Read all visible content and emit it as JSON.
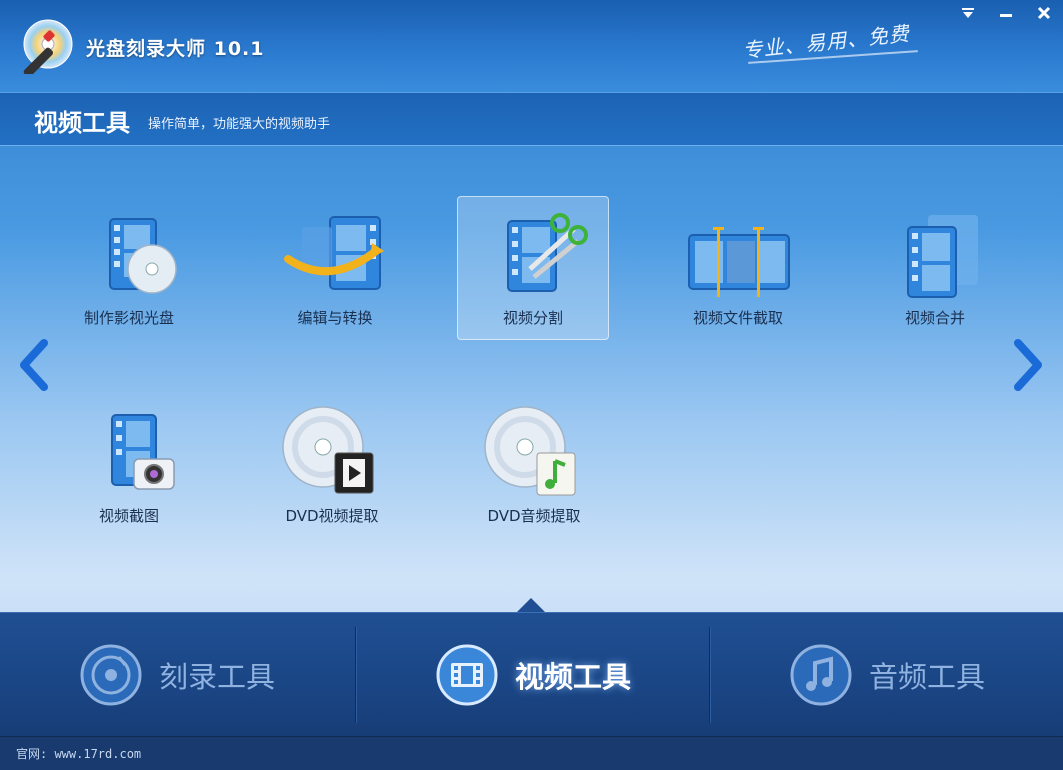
{
  "window": {
    "title": "光盘刻录大师 10.1",
    "slogan": "专业、易用、免费",
    "buttons": [
      "menu",
      "minimize",
      "close"
    ]
  },
  "subheader": {
    "title": "视频工具",
    "description": "操作简单，功能强大的视频助手"
  },
  "tools": [
    {
      "label": "制作影视光盘",
      "icon": "film-disc-icon"
    },
    {
      "label": "编辑与转换",
      "icon": "film-convert-icon"
    },
    {
      "label": "视频分割",
      "icon": "film-scissors-icon",
      "selected": true
    },
    {
      "label": "视频文件截取",
      "icon": "film-crop-icon"
    },
    {
      "label": "视频合并",
      "icon": "film-merge-icon"
    },
    {
      "label": "视频截图",
      "icon": "film-camera-icon"
    },
    {
      "label": "DVD视频提取",
      "icon": "dvd-video-icon"
    },
    {
      "label": "DVD音频提取",
      "icon": "dvd-audio-icon"
    }
  ],
  "tabs": [
    {
      "label": "刻录工具",
      "icon": "disc-icon"
    },
    {
      "label": "视频工具",
      "icon": "film-icon",
      "active": true
    },
    {
      "label": "音频工具",
      "icon": "music-note-icon"
    }
  ],
  "footer": {
    "text": "官网: www.17rd.com"
  },
  "colors": {
    "accent": "#2a7ad0",
    "tab_bar": "#1f4f92",
    "label_text": "#1a3050"
  }
}
